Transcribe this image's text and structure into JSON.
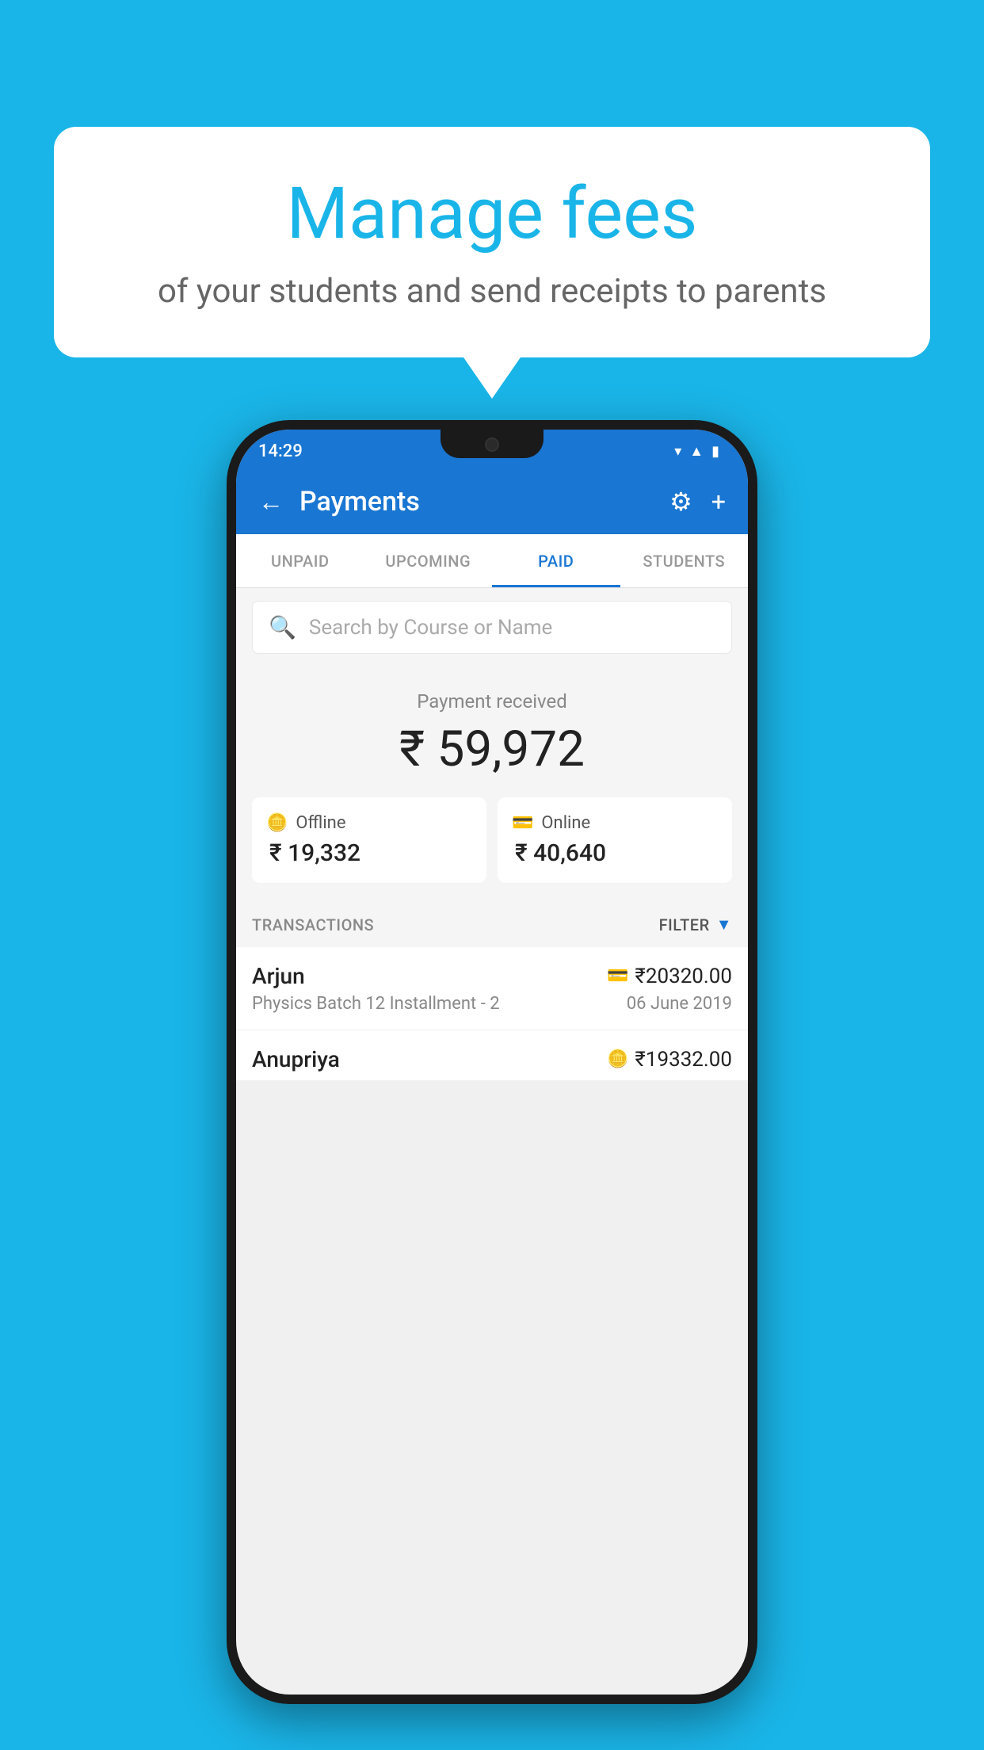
{
  "background_color": "#1ab5e8",
  "bubble": {
    "title": "Manage fees",
    "subtitle": "of your students and send receipts to parents"
  },
  "status_bar": {
    "time": "14:29",
    "icons": [
      "wifi",
      "signal",
      "battery"
    ]
  },
  "top_bar": {
    "title": "Payments",
    "back_label": "←",
    "settings_label": "⚙",
    "add_label": "+"
  },
  "tabs": [
    {
      "label": "UNPAID",
      "active": false
    },
    {
      "label": "UPCOMING",
      "active": false
    },
    {
      "label": "PAID",
      "active": true
    },
    {
      "label": "STUDENTS",
      "active": false
    }
  ],
  "search": {
    "placeholder": "Search by Course or Name"
  },
  "payment_summary": {
    "received_label": "Payment received",
    "total_amount": "₹ 59,972",
    "offline_label": "Offline",
    "offline_amount": "₹ 19,332",
    "online_label": "Online",
    "online_amount": "₹ 40,640"
  },
  "transactions": {
    "header_label": "TRANSACTIONS",
    "filter_label": "FILTER",
    "items": [
      {
        "name": "Arjun",
        "course": "Physics Batch 12 Installment - 2",
        "amount": "₹20320.00",
        "date": "06 June 2019",
        "payment_type": "online"
      },
      {
        "name": "Anupriya",
        "course": "",
        "amount": "₹19332.00",
        "date": "",
        "payment_type": "offline"
      }
    ]
  }
}
